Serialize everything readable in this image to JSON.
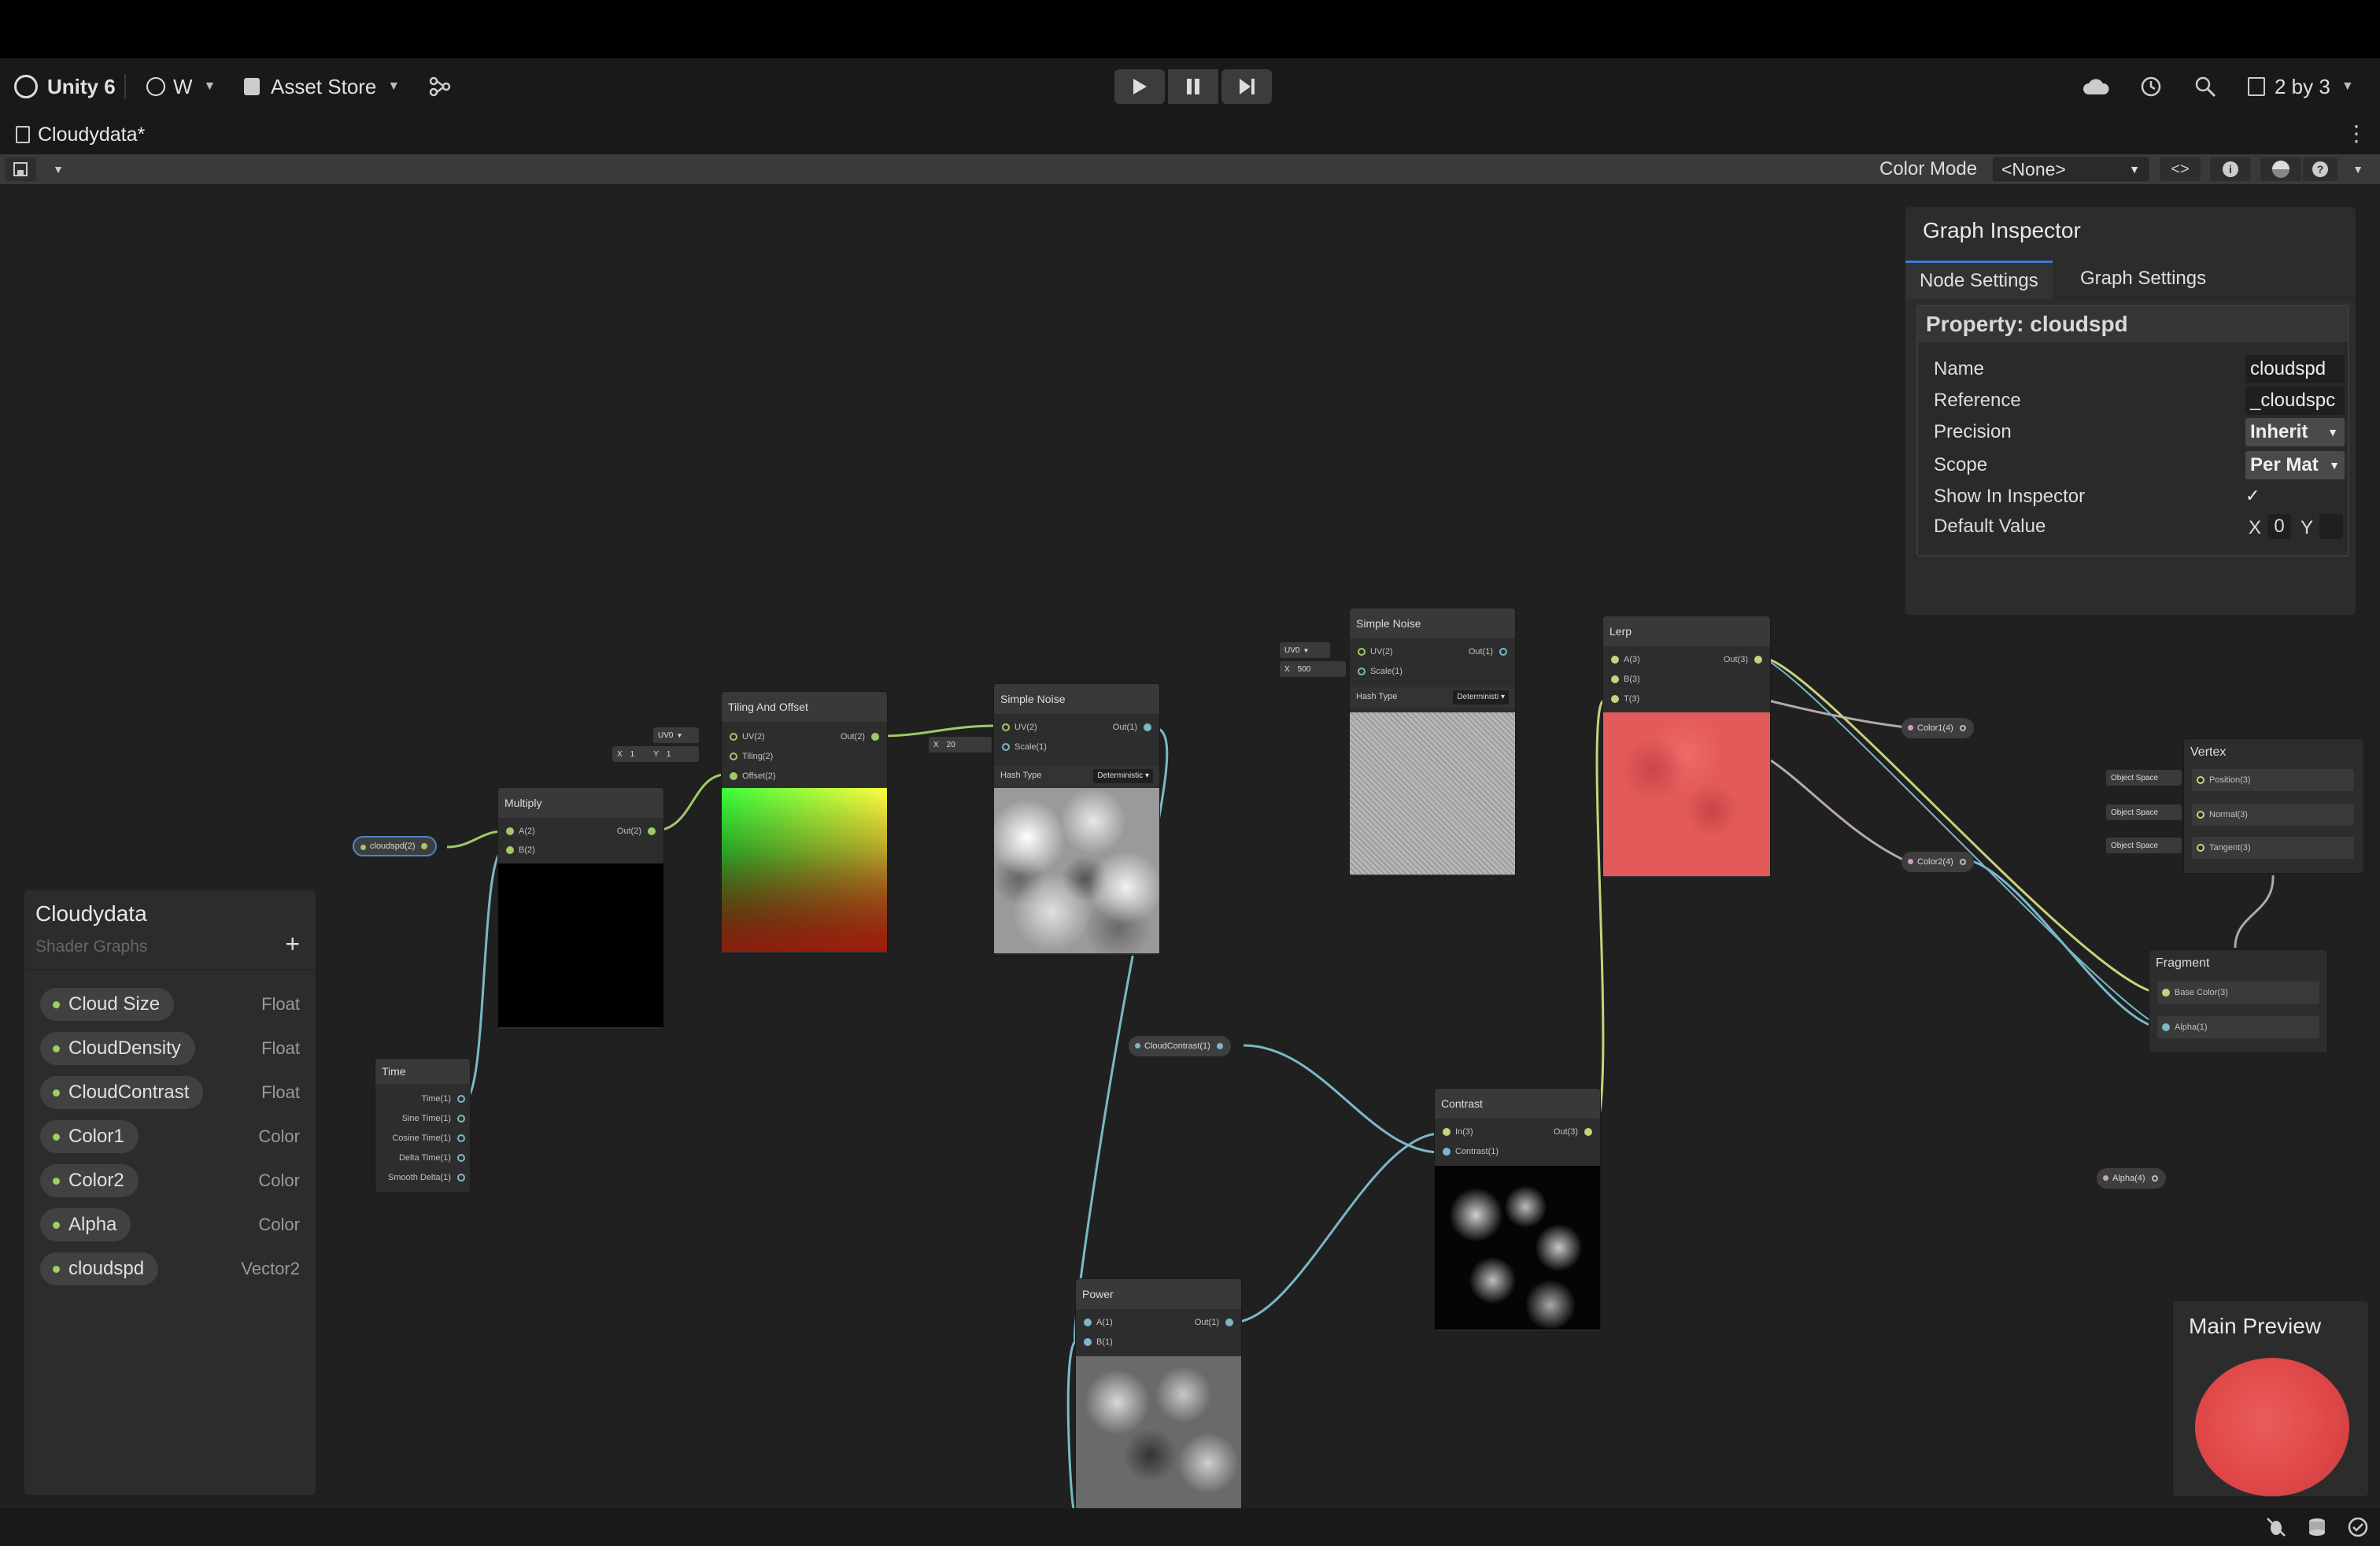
{
  "toolbar": {
    "app_name": "Unity 6",
    "account_label": "W",
    "asset_store_label": "Asset Store",
    "layout_label": "2 by 3"
  },
  "tab": {
    "title": "Cloudydata*"
  },
  "subbar": {
    "color_mode_label": "Color Mode",
    "color_mode_value": "<None>"
  },
  "nodes": {
    "multiply": {
      "title": "Multiply",
      "in_a": "A(2)",
      "in_b": "B(2)",
      "out": "Out(2)"
    },
    "tiling": {
      "title": "Tiling And Offset",
      "in_uv": "UV(2)",
      "in_tiling": "Tiling(2)",
      "in_offset": "Offset(2)",
      "out": "Out(2)",
      "uv_field": "UV0",
      "x_label": "X",
      "x_value": "1",
      "y_label": "Y",
      "y_value": "1"
    },
    "noise1": {
      "title": "Simple Noise",
      "in_uv": "UV(2)",
      "in_scale": "Scale(1)",
      "out": "Out(1)",
      "hash_label": "Hash Type",
      "hash_value": "Deterministic",
      "scale_x_label": "X",
      "scale_value": "20"
    },
    "noise2": {
      "title": "Simple Noise",
      "in_uv": "UV(2)",
      "in_scale": "Scale(1)",
      "out": "Out(1)",
      "hash_label": "Hash Type",
      "hash_value": "Deterministi",
      "uv_field": "UV0",
      "scale_x_label": "X",
      "scale_value": "500"
    },
    "lerp": {
      "title": "Lerp",
      "in_a": "A(3)",
      "in_b": "B(3)",
      "in_t": "T(3)",
      "out": "Out(3)"
    },
    "time": {
      "title": "Time",
      "outputs": [
        "Time(1)",
        "Sine Time(1)",
        "Cosine Time(1)",
        "Delta Time(1)",
        "Smooth Delta(1)"
      ]
    },
    "contrast": {
      "title": "Contrast",
      "in_in": "In(3)",
      "in_contrast": "Contrast(1)",
      "out": "Out(3)"
    },
    "power": {
      "title": "Power",
      "in_a": "A(1)",
      "in_b": "B(1)",
      "out": "Out(1)"
    },
    "vertex": {
      "title": "Vertex",
      "ports": [
        "Position(3)",
        "Normal(3)",
        "Tangent(3)"
      ],
      "space_label": "Object Space"
    },
    "fragment": {
      "title": "Fragment",
      "ports": [
        "Base Color(3)",
        "Alpha(1)"
      ]
    }
  },
  "pills": {
    "cloudspd": "cloudspd(2)",
    "color1": "Color1(4)",
    "color2": "Color2(4)",
    "cloudcontrast": "CloudContrast(1)",
    "alpha": "Alpha(4)"
  },
  "blackboard": {
    "title": "Cloudydata",
    "subtitle": "Shader Graphs",
    "add_label": "+",
    "properties": [
      {
        "name": "Cloud Size",
        "type": "Float"
      },
      {
        "name": "CloudDensity",
        "type": "Float"
      },
      {
        "name": "CloudContrast",
        "type": "Float"
      },
      {
        "name": "Color1",
        "type": "Color"
      },
      {
        "name": "Color2",
        "type": "Color"
      },
      {
        "name": "Alpha",
        "type": "Color"
      },
      {
        "name": "cloudspd",
        "type": "Vector2"
      }
    ]
  },
  "inspector": {
    "title": "Graph Inspector",
    "tabs": [
      "Node Settings",
      "Graph Settings"
    ],
    "property_title": "Property: cloudspd",
    "rows": [
      {
        "label": "Name",
        "value": "cloudspd"
      },
      {
        "label": "Reference",
        "value": "_cloudspc"
      },
      {
        "label": "Precision",
        "value": "Inherit"
      },
      {
        "label": "Scope",
        "value": "Per Mat"
      },
      {
        "label": "Show In Inspector",
        "value": "✓"
      },
      {
        "label": "Default Value",
        "x_label": "X",
        "x_value": "0",
        "y_label": "Y"
      }
    ]
  },
  "main_preview": {
    "title": "Main Preview"
  },
  "colors": {
    "accent": "#3d7bd6",
    "lerp_preview": "#e05858",
    "edge_green": "#c8d27a",
    "edge_blue": "#7ab8c8",
    "edge_gray": "#b8a8a8"
  }
}
